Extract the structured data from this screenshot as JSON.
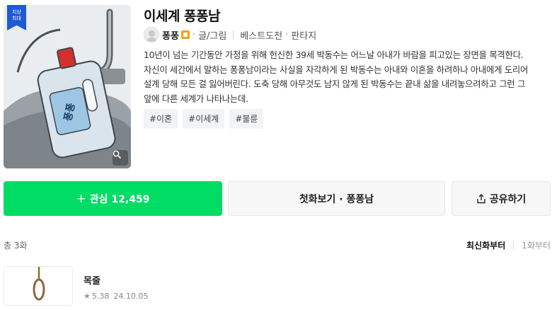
{
  "webtoon": {
    "title": "이세계 퐁퐁남",
    "thumbnail_badge": [
      "지상",
      "최대"
    ],
    "author": "퐁퐁",
    "role": "글/그림",
    "category": "베스트도전",
    "genre": "판타지",
    "description": [
      "10년이 넘는 기간동안 가정을 위해 헌신한 39세 박동수는 어느날 아내가 바람을 피고있는 장면을 목격한다.",
      "자신이 세간에서 말하는 퐁퐁남이라는 사실을 자각하게 된 박동수는 아내와 이혼을 하려하나 아내에게 도리어",
      "설계 당해 모든 걸 잃어버린다. 도축 당해 아무것도 남지 않게 된 박동수는 끝내 삶을 내려놓으려하고 그런 그",
      "앞에 다른 세계가 나타나는데."
    ],
    "tags": [
      "#이혼",
      "#이세계",
      "#불륜"
    ]
  },
  "actions": {
    "favorite_prefix": "+",
    "favorite_label": "관심 12,459",
    "first_episode_label": "첫화보기 · 퐁퐁남",
    "share_label": "공유하기"
  },
  "episode_list": {
    "count_label": "총 3화",
    "sort_active": "최신화부터",
    "sort_inactive": "1화부터",
    "episodes": [
      {
        "title": "목줄",
        "rating": "5.38",
        "date": "24.10.05"
      }
    ]
  },
  "icons": {
    "zoom": "magnifier-icon",
    "share": "share-icon",
    "star": "star-icon"
  },
  "colors": {
    "accent_green": "#00dc64",
    "badge_blue": "#1f5ad6"
  }
}
